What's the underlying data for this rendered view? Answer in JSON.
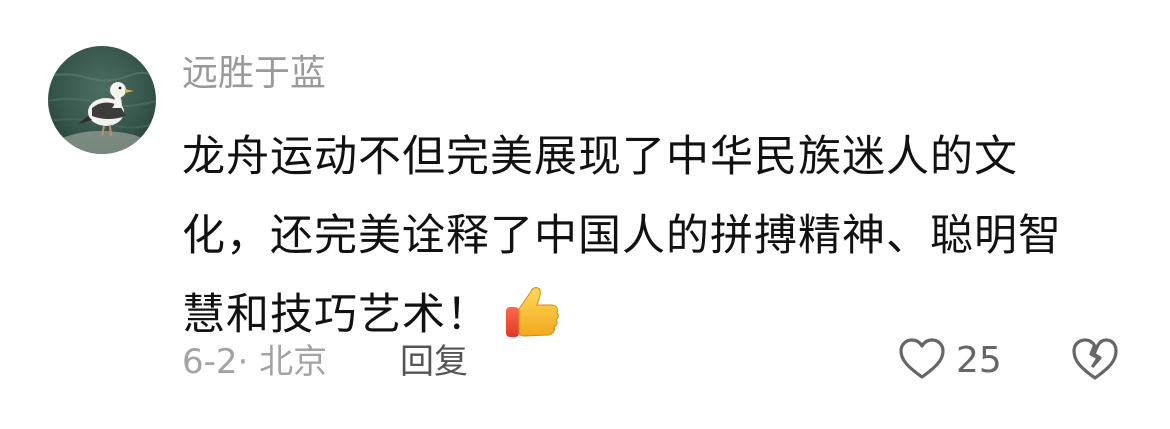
{
  "comment": {
    "username": "远胜于蓝",
    "text": "龙舟运动不但完美展现了中华民族迷人的文化，还完美诠释了中国人的拼搏精神、聪明智慧和技巧艺术！",
    "emoji": "thumbs-up-icon",
    "date_location": "6-2· 北京",
    "reply_label": "回复",
    "like_count": "25",
    "like_icon": "heart-outline-icon",
    "dislike_icon": "broken-heart-icon"
  },
  "colors": {
    "username": "#9a9a9a",
    "text": "#111111",
    "meta": "#a3a3a3",
    "icon": "#666666"
  }
}
